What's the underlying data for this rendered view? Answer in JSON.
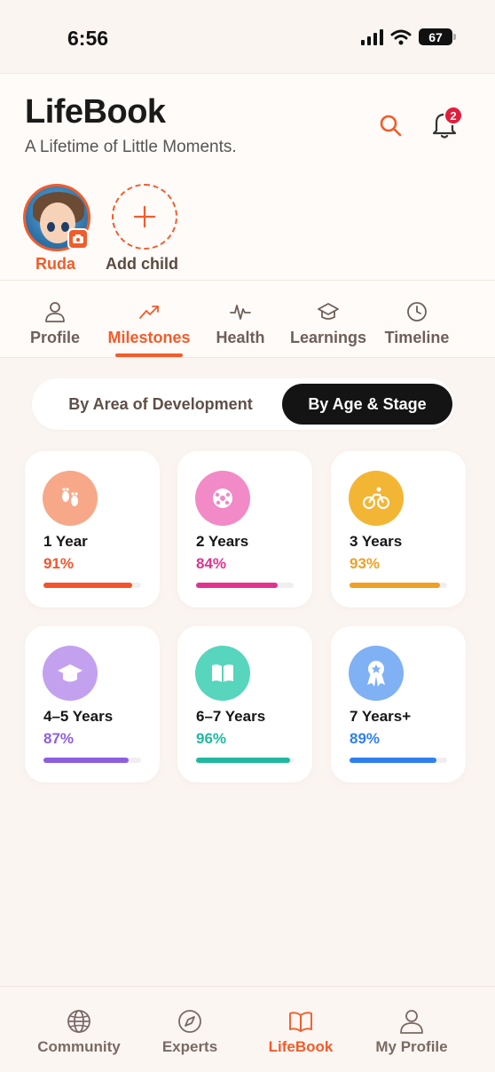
{
  "status_bar": {
    "time": "6:56",
    "battery": "67"
  },
  "header": {
    "title": "LifeBook",
    "subtitle": "A Lifetime of Little Moments.",
    "notification_count": "2",
    "icons": [
      "search-icon",
      "bell-icon"
    ]
  },
  "children": {
    "selected_name": "Ruda",
    "add_label": "Add child"
  },
  "tabs": [
    {
      "label": "Profile",
      "icon": "user-icon"
    },
    {
      "label": "Milestones",
      "icon": "trend-up-icon",
      "active": true
    },
    {
      "label": "Health",
      "icon": "pulse-icon"
    },
    {
      "label": "Learnings",
      "icon": "graduation-cap-icon"
    },
    {
      "label": "Timeline",
      "icon": "clock-icon"
    }
  ],
  "segment": {
    "left_label": "By Area of Development",
    "right_label": "By Age & Stage",
    "selected": "By Age & Stage"
  },
  "cards": [
    {
      "title": "1 Year",
      "percent": "91%",
      "progress": 0.91,
      "color": "#f4532b",
      "icon_bg": "#f7a888",
      "icon": "footprints-icon"
    },
    {
      "title": "2 Years",
      "percent": "84%",
      "progress": 0.84,
      "color": "#e0338f",
      "icon_bg": "#f18ac6",
      "icon": "ball-icon"
    },
    {
      "title": "3 Years",
      "percent": "93%",
      "progress": 0.93,
      "color": "#f0a023",
      "icon_bg": "#f3b534",
      "icon": "bicycle-icon"
    },
    {
      "title": "4–5 Years",
      "percent": "87%",
      "progress": 0.87,
      "color": "#8d5ee0",
      "icon_bg": "#c3a1ef",
      "icon": "graduation-cap-icon"
    },
    {
      "title": "6–7 Years",
      "percent": "96%",
      "progress": 0.96,
      "color": "#21b8a0",
      "icon_bg": "#57d5bd",
      "icon": "book-icon"
    },
    {
      "title": "7 Years+",
      "percent": "89%",
      "progress": 0.89,
      "color": "#2f7ff0",
      "icon_bg": "#7fb1f4",
      "icon": "award-icon"
    }
  ],
  "bottom_nav": [
    {
      "label": "Community",
      "icon": "globe-icon"
    },
    {
      "label": "Experts",
      "icon": "compass-icon"
    },
    {
      "label": "LifeBook",
      "icon": "book-open-icon",
      "active": true
    },
    {
      "label": "My Profile",
      "icon": "user-icon"
    }
  ],
  "colors": {
    "accent": "#f25c2a",
    "background": "#fbf5f2"
  }
}
